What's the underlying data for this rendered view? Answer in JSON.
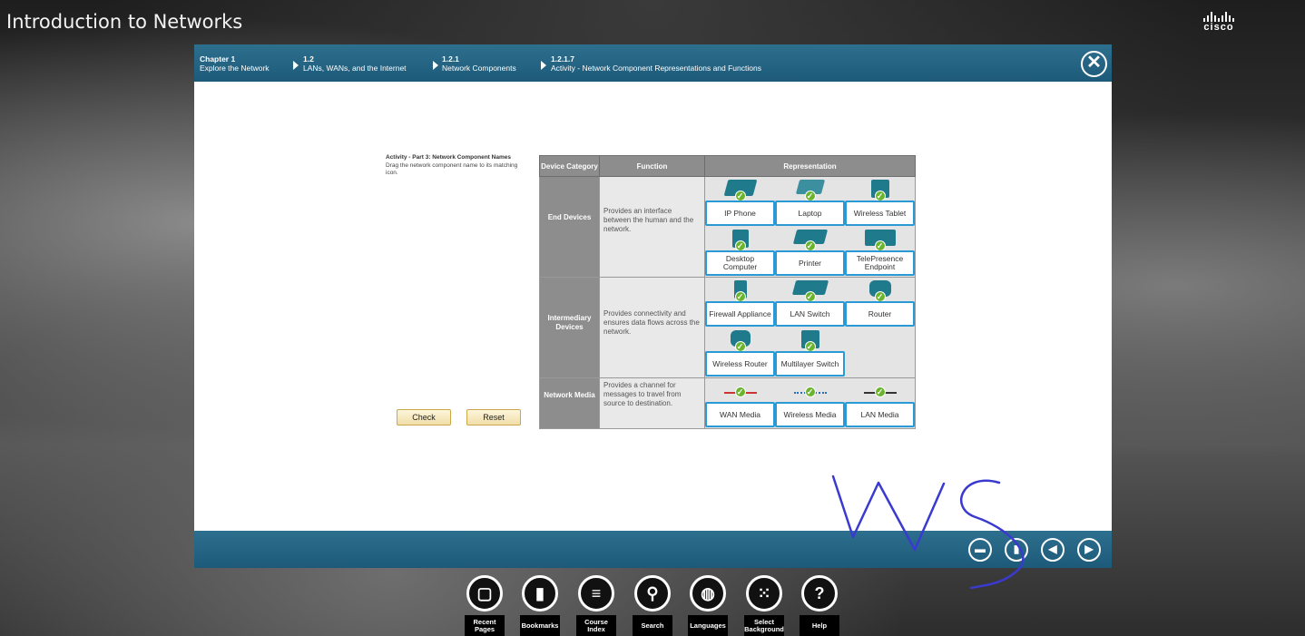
{
  "app": {
    "title": "Introduction to Networks",
    "brand": "cisco"
  },
  "breadcrumb": [
    {
      "num": "Chapter 1",
      "label": "Explore the Network"
    },
    {
      "num": "1.2",
      "label": "LANs, WANs, and the Internet"
    },
    {
      "num": "1.2.1",
      "label": "Network Components"
    },
    {
      "num": "1.2.1.7",
      "label": "Activity - Network Component Representations and Functions"
    }
  ],
  "instructions": {
    "heading": "Activity - Part 3: Network Component Names",
    "body": "Drag the network component name to its matching icon."
  },
  "buttons": {
    "check": "Check",
    "reset": "Reset"
  },
  "table": {
    "headers": [
      "Device Category",
      "Function",
      "Representation"
    ],
    "rows": [
      {
        "category": "End Devices",
        "function": "Provides an interface between the human and the network.",
        "labels": [
          "IP Phone",
          "Laptop",
          "Wireless Tablet",
          "Desktop Computer",
          "Printer",
          "TelePresence Endpoint"
        ]
      },
      {
        "category": "Intermediary Devices",
        "function": "Provides connectivity and ensures data flows across the network.",
        "labels": [
          "Firewall Appliance",
          "LAN Switch",
          "Router",
          "Wireless Router",
          "Multilayer Switch"
        ]
      },
      {
        "category": "Network Media",
        "function": "Provides a channel for messages to travel from source to destination.",
        "labels": [
          "WAN Media",
          "Wireless Media",
          "LAN Media"
        ]
      }
    ]
  },
  "dock": [
    {
      "label": "Recent Pages",
      "icon": "pages-icon"
    },
    {
      "label": "Bookmarks",
      "icon": "bookmark-icon"
    },
    {
      "label": "Course Index",
      "icon": "list-icon"
    },
    {
      "label": "Search",
      "icon": "search-icon"
    },
    {
      "label": "Languages",
      "icon": "globe-icon"
    },
    {
      "label": "Select Background",
      "icon": "grid-icon"
    },
    {
      "label": "Help",
      "icon": "help-icon"
    }
  ],
  "annotation": {
    "text": "WS",
    "color": "#3a3ad0"
  },
  "colors": {
    "accent": "#1d5a79",
    "label_border": "#2a9ad6",
    "check": "#6ab42e"
  }
}
